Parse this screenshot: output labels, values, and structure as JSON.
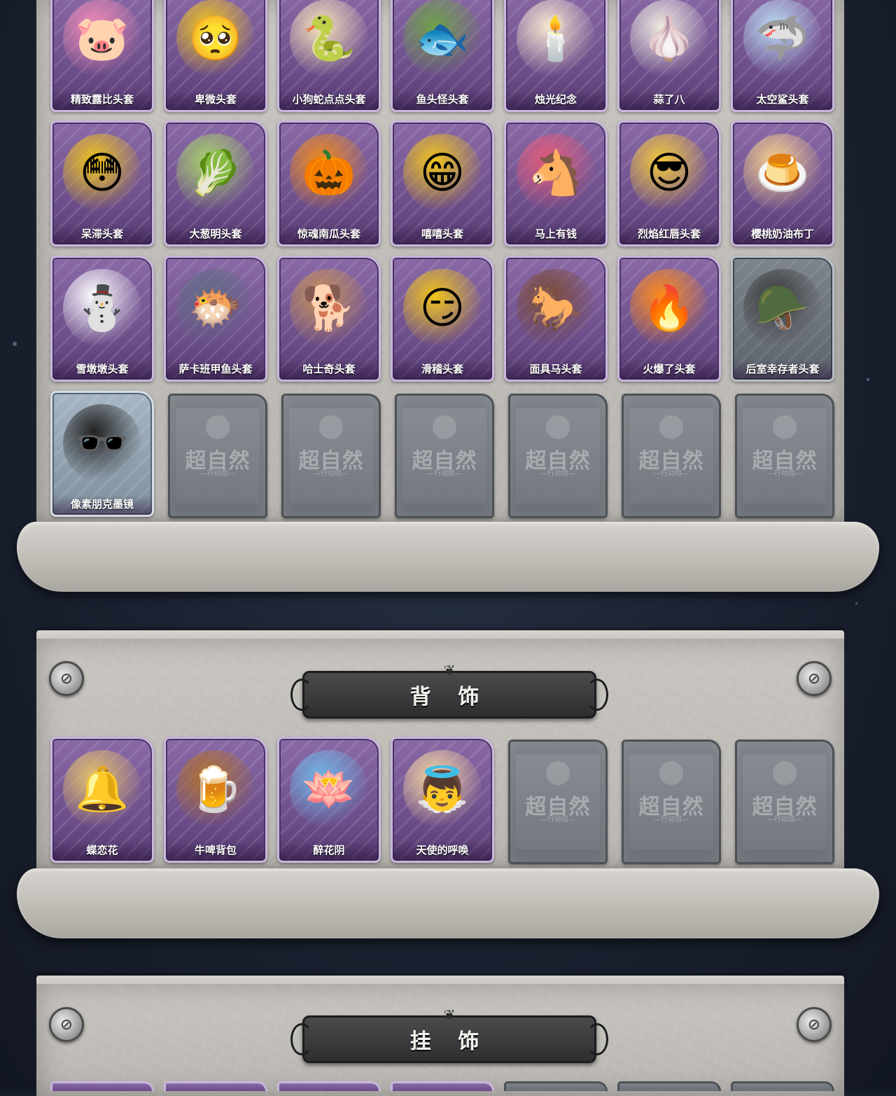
{
  "sections": {
    "headwear": {
      "items": [
        {
          "label": "精致露比头套",
          "icon": "pink-seal-mask",
          "emoji": "🐷",
          "tint": "#f28bb5",
          "style": "purple"
        },
        {
          "label": "卑微头套",
          "icon": "worried-face-mask",
          "emoji": "🥺",
          "tint": "#f0c419",
          "style": "purple"
        },
        {
          "label": "小狗蛇点点头套",
          "icon": "snake-mask",
          "emoji": "🐍",
          "tint": "#f5e2b8",
          "style": "purple"
        },
        {
          "label": "鱼头怪头套",
          "icon": "fish-head-mask",
          "emoji": "🐟",
          "tint": "#6fa04a",
          "style": "purple"
        },
        {
          "label": "烛光纪念",
          "icon": "candle-mask",
          "emoji": "🕯️",
          "tint": "#f4e4cf",
          "style": "purple"
        },
        {
          "label": "蒜了八",
          "icon": "garlic-mask",
          "emoji": "🧄",
          "tint": "#eeeae0",
          "style": "purple"
        },
        {
          "label": "太空鲨头套",
          "icon": "space-shark-mask",
          "emoji": "🦈",
          "tint": "#b9d9f2",
          "style": "purple"
        },
        {
          "label": "呆滞头套",
          "icon": "flushed-face-mask",
          "emoji": "😳",
          "tint": "#f0c419",
          "style": "purple"
        },
        {
          "label": "大葱明头套",
          "icon": "scallion-mask",
          "emoji": "🥬",
          "tint": "#a8d26a",
          "style": "purple"
        },
        {
          "label": "惊魂南瓜头套",
          "icon": "pumpkin-mask",
          "emoji": "🎃",
          "tint": "#f08a1a",
          "style": "purple"
        },
        {
          "label": "嘻嘻头套",
          "icon": "grin-face-mask",
          "emoji": "😁",
          "tint": "#f0c419",
          "style": "purple"
        },
        {
          "label": "马上有钱",
          "icon": "lucky-horse-mask",
          "emoji": "🐴",
          "tint": "#e45a7a",
          "style": "purple"
        },
        {
          "label": "烈焰红唇头套",
          "icon": "pikachu-shades-mask",
          "emoji": "😎",
          "tint": "#f4c93a",
          "style": "purple"
        },
        {
          "label": "樱桃奶油布丁",
          "icon": "pudding-mask",
          "emoji": "🍮",
          "tint": "#f7d08a",
          "style": "purple"
        },
        {
          "label": "雪墩墩头套",
          "icon": "snowman-mask",
          "emoji": "⛄",
          "tint": "#ffffff",
          "style": "purple"
        },
        {
          "label": "萨卡班甲鱼头套",
          "icon": "sacabambaspis-mask",
          "emoji": "🐡",
          "tint": "#5f6b84",
          "style": "purple"
        },
        {
          "label": "哈士奇头套",
          "icon": "husky-shades-mask",
          "emoji": "🐕",
          "tint": "#c69055",
          "style": "purple"
        },
        {
          "label": "滑稽头套",
          "icon": "smirk-face-mask",
          "emoji": "😏",
          "tint": "#f0c419",
          "style": "purple"
        },
        {
          "label": "面具马头套",
          "icon": "horse-head-mask",
          "emoji": "🐎",
          "tint": "#7a4a34",
          "style": "purple"
        },
        {
          "label": "火爆了头套",
          "icon": "fire-spirit-mask",
          "emoji": "🔥",
          "tint": "#ff8a1a",
          "style": "purple"
        },
        {
          "label": "后室幸存者头套",
          "icon": "gas-mask-helmet",
          "emoji": "🪖",
          "tint": "#3a3a3a",
          "style": "grey"
        },
        {
          "label": "像素朋克墨镜",
          "icon": "pixel-sunglasses",
          "emoji": "🕶️",
          "tint": "#222222",
          "style": "bluegrey"
        }
      ],
      "locked_count": 6
    },
    "back": {
      "title": "背 饰",
      "items": [
        {
          "label": "蝶恋花",
          "icon": "butterfly-bell-wreath",
          "emoji": "🔔",
          "tint": "#e6c36a",
          "style": "purple"
        },
        {
          "label": "牛啤背包",
          "icon": "cow-beer-mug-backpack",
          "emoji": "🍺",
          "tint": "#b0712d",
          "style": "purple"
        },
        {
          "label": "醉花阴",
          "icon": "flower-dreamcatcher",
          "emoji": "🪷",
          "tint": "#6fb6e6",
          "style": "purple"
        },
        {
          "label": "天使的呼唤",
          "icon": "angel-doll",
          "emoji": "👼",
          "tint": "#f6d7a0",
          "style": "purple"
        }
      ],
      "locked_count": 3
    },
    "pendant": {
      "title": "挂 饰"
    }
  },
  "locked_card": {
    "logo": "超自然",
    "sub": "—行动组—"
  },
  "rivet_glyph": "⊘"
}
